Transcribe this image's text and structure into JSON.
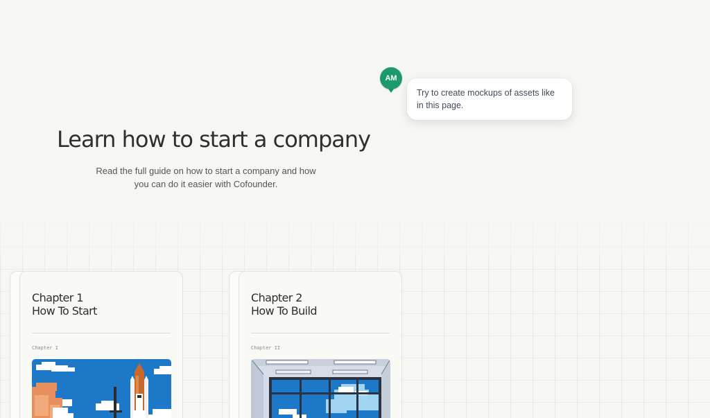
{
  "hero": {
    "title": "Learn how to start a company",
    "subtitle": "Read the full guide on how to start a company and how you can do it easier with Cofounder."
  },
  "comment": {
    "avatar_initials": "AM",
    "avatar_color": "#1d9a6c",
    "text": "Try to create mockups of assets like in this page."
  },
  "chapters": [
    {
      "title_line1": "Chapter 1",
      "title_line2": "How To Start",
      "tag": "Chapter I",
      "image_icon": "space-shuttle-illustration"
    },
    {
      "title_line1": "Chapter 2",
      "title_line2": "How To Build",
      "tag": "Chapter II",
      "image_icon": "office-window-illustration"
    }
  ],
  "colors": {
    "background": "#f6f6f2",
    "accent": "#1d9a6c",
    "sky": "#1e78c8"
  }
}
